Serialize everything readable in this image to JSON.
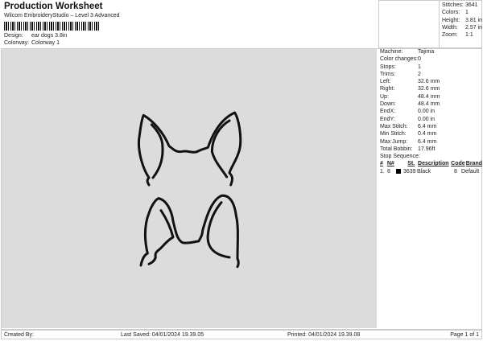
{
  "header": {
    "title": "Production Worksheet",
    "subtitle": "Wilcom EmbroideryStudio – Level 3 Advanced",
    "design_label": "Design:",
    "design_value": "ear  dogs 3.8in",
    "colorway_label": "Colorway:",
    "colorway_value": "Colorway 1"
  },
  "summary": [
    {
      "k": "Stitches:",
      "v": "3641"
    },
    {
      "k": "Colors:",
      "v": "1"
    },
    {
      "k": "Height:",
      "v": "3.81 in"
    },
    {
      "k": "Width:",
      "v": "2.57 in"
    },
    {
      "k": "Zoom:",
      "v": "1:1"
    }
  ],
  "details": [
    {
      "k": "Machine:",
      "v": "Tajima"
    },
    {
      "k": "Color changes:",
      "v": "0"
    },
    {
      "k": "Stops:",
      "v": "1"
    },
    {
      "k": "Trims:",
      "v": "2"
    },
    {
      "k": "Left:",
      "v": "32.6 mm"
    },
    {
      "k": "Right:",
      "v": "32.6 mm"
    },
    {
      "k": "Up:",
      "v": "48.4 mm"
    },
    {
      "k": "Down:",
      "v": "48.4 mm"
    },
    {
      "k": "EndX:",
      "v": "0.00 in"
    },
    {
      "k": "EndY:",
      "v": "0.00 in"
    },
    {
      "k": "Max Stitch:",
      "v": "6.4 mm"
    },
    {
      "k": "Min Stitch:",
      "v": "0.4 mm"
    },
    {
      "k": "Max Jump:",
      "v": "6.4 mm"
    },
    {
      "k": "Total Bobbin:",
      "v": "17.96ft"
    }
  ],
  "stop_sequence": {
    "title": "Stop Sequence:",
    "headers": [
      "#",
      "N#",
      "St.",
      "Description",
      "Code",
      "Brand"
    ],
    "rows": [
      {
        "num": "1.",
        "n": "8",
        "st": "3639",
        "color": "#000000",
        "description": "Black",
        "code": "8",
        "brand": "Default"
      }
    ]
  },
  "footer": {
    "created_by": "Created By:",
    "last_saved": "Last Saved: 04/01/2024 19.39.05",
    "printed": "Printed: 04/01/2024 19.39.08",
    "page": "Page 1 of 1"
  }
}
